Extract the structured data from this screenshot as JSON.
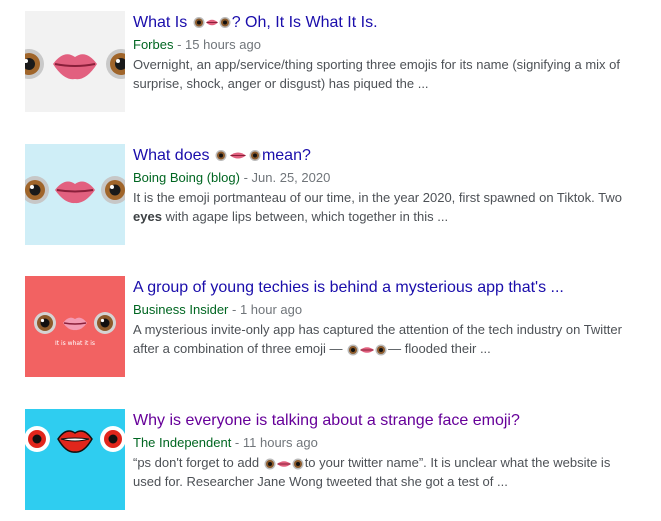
{
  "results": [
    {
      "title_before": "What Is ",
      "title_after": "? Oh, It Is What It Is.",
      "source": "Forbes",
      "separator": " - ",
      "time": "15 hours ago",
      "snippet_line1": "Overnight, an app/service/thing sporting three emojis for its name (signifying a mix of",
      "snippet_line2": "surprise, shock, anger or disgust) has piqued the ..."
    },
    {
      "title_before": "What does ",
      "title_after": "mean?",
      "source": "Boing Boing (blog)",
      "separator": " - ",
      "time": "Jun. 25, 2020",
      "snippet_line1": "It is the emoji portmanteau of our time, in the year 2020, first spawned on Tiktok. Two",
      "snippet_bold": "eyes",
      "snippet_line2_rest": " with agape lips between, which together in this ..."
    },
    {
      "title": "A group of young techies is behind a mysterious app that's ...",
      "source": "Business Insider",
      "separator": " - ",
      "time": "1 hour ago",
      "thumb_caption": "It is what it is",
      "snippet_line1": "A mysterious invite-only app has captured the attention of the tech industry on Twitter",
      "snippet_line2_before": "after a combination of three emoji — ",
      "snippet_line2_after": "— flooded their ..."
    },
    {
      "title": "Why is everyone is talking about a strange face emoji?",
      "source": "The Independent",
      "separator": " - ",
      "time": "11 hours ago",
      "snippet_line1_before": "“ps don't forget to add ",
      "snippet_line1_after": "to your twitter name”. It is unclear what the website is",
      "snippet_line2": "used for. Researcher Jane Wong tweeted that she got a test of ..."
    }
  ],
  "colors": {
    "link": "#1a0dab",
    "visited": "#660099",
    "source": "#006621",
    "muted": "#70757a",
    "snippet": "#4d5156",
    "thumb1_bg": "#f2f2f2",
    "thumb2_bg": "#cfeef7",
    "thumb3_bg": "#f26262",
    "thumb4_bg": "#2fcdf0"
  },
  "icons": [
    "eye-emoji-icon",
    "lips-emoji-icon",
    "eye-emoji-icon"
  ]
}
